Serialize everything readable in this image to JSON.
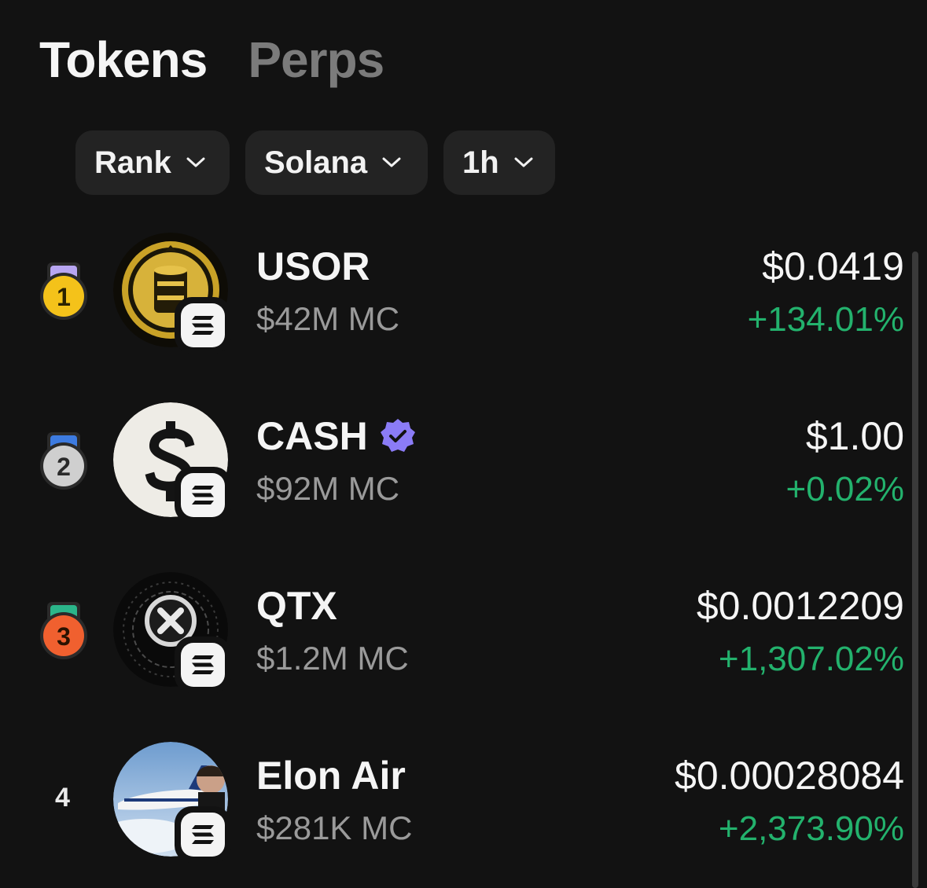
{
  "tabs": [
    {
      "label": "Tokens",
      "active": true
    },
    {
      "label": "Perps",
      "active": false
    }
  ],
  "filters": [
    {
      "label": "Rank",
      "icon": "chevron-down-icon"
    },
    {
      "label": "Solana",
      "icon": "chevron-down-icon"
    },
    {
      "label": "1h",
      "icon": "chevron-down-icon"
    }
  ],
  "tokens": [
    {
      "rank": "1",
      "rank_style": "gold-medal",
      "name": "USOR",
      "verified": false,
      "market_cap": "$42M MC",
      "price": "$0.0419",
      "change": "+134.01%",
      "chain_icon": "solana-icon"
    },
    {
      "rank": "2",
      "rank_style": "silver-medal",
      "name": "CASH",
      "verified": true,
      "market_cap": "$92M MC",
      "price": "$1.00",
      "change": "+0.02%",
      "chain_icon": "solana-icon"
    },
    {
      "rank": "3",
      "rank_style": "bronze-medal",
      "name": "QTX",
      "verified": false,
      "market_cap": "$1.2M MC",
      "price": "$0.0012209",
      "change": "+1,307.02%",
      "chain_icon": "solana-icon"
    },
    {
      "rank": "4",
      "rank_style": "plain",
      "name": "Elon Air",
      "verified": false,
      "market_cap": "$281K MC",
      "price": "$0.00028084",
      "change": "+2,373.90%",
      "chain_icon": "solana-icon"
    }
  ],
  "colors": {
    "background": "#121212",
    "positive_change": "#23b26d",
    "verified_badge": "#8b7cf6",
    "gold": "#f4c21a",
    "silver": "#cfcfcf",
    "bronze": "#f0602f"
  }
}
